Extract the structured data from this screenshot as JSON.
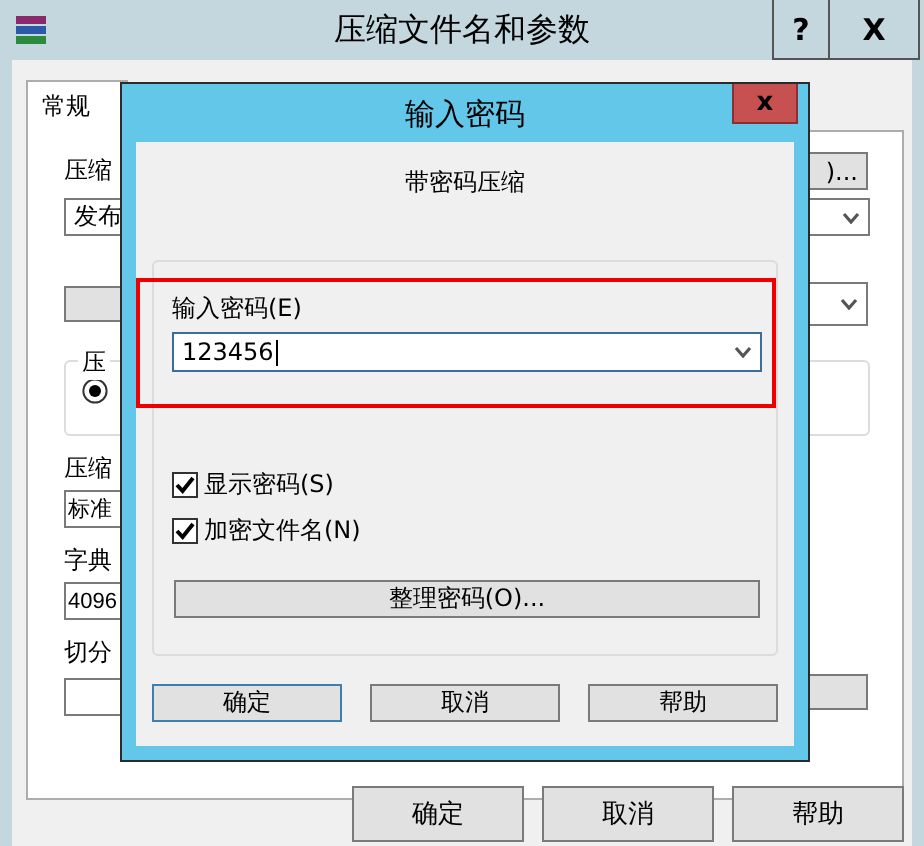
{
  "window": {
    "title": "压缩文件名和参数",
    "help_button": "?",
    "close_button": "X"
  },
  "tabs": [
    {
      "label": "常规",
      "selected": true
    }
  ],
  "general": {
    "archive_name_label": "压缩",
    "archive_name": "发布",
    "browse_button": ")...",
    "format_group_label": "压",
    "format_radio": {
      "selected": true
    },
    "method_label": "压缩",
    "method": "标准",
    "dictionary_label": "字典",
    "dictionary": "4096",
    "split_label": "切分"
  },
  "buttons": [
    "确定",
    "取消",
    "帮助"
  ],
  "password_dialog": {
    "title": "输入密码",
    "close_button": "x",
    "heading": "带密码压缩",
    "password_label": "输入密码(E)",
    "password": "123456",
    "options": [
      {
        "label": "显示密码(S)",
        "checked": true
      },
      {
        "label": "加密文件名(N)",
        "checked": true
      }
    ],
    "organize_button": "整理密码(O)...",
    "buttons": [
      {
        "label": "确定",
        "default": true
      },
      {
        "label": "取消",
        "default": false
      },
      {
        "label": "帮助",
        "default": false
      }
    ]
  }
}
